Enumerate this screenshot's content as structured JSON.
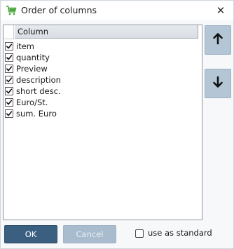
{
  "window": {
    "title": "Order of columns",
    "close_glyph": "✕",
    "app_icon": "shopping-cart-icon"
  },
  "list": {
    "header_label": "Column",
    "items": [
      {
        "label": "item",
        "checked": true
      },
      {
        "label": "quantity",
        "checked": true
      },
      {
        "label": "Preview",
        "checked": true
      },
      {
        "label": "description",
        "checked": true
      },
      {
        "label": "short desc.",
        "checked": true
      },
      {
        "label": "Euro/St.",
        "checked": true
      },
      {
        "label": "sum. Euro",
        "checked": true
      }
    ]
  },
  "side_buttons": {
    "up_icon": "arrow-up-icon",
    "down_icon": "arrow-down-icon"
  },
  "footer": {
    "ok_label": "OK",
    "cancel_label": "Cancel",
    "standard_label": "use as standard",
    "standard_checked": false
  },
  "colors": {
    "ok_bg": "#3b5f80",
    "disabled_bg": "#a9bccd",
    "side_button_bg": "#b4c5d6",
    "cart_green": "#4aa63c"
  }
}
